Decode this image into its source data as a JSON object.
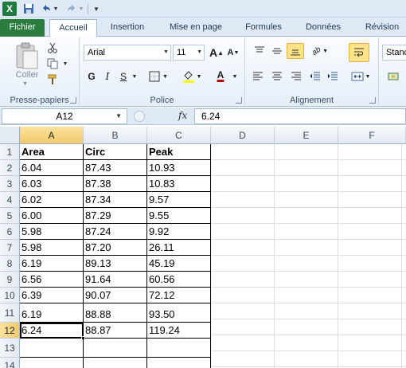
{
  "qat": {
    "app_icon": "excel-icon",
    "save_icon": "save-icon",
    "undo_icon": "undo-icon",
    "redo_icon": "redo-icon",
    "customize_icon": "chevron-down-icon"
  },
  "tabs": [
    {
      "label": "Fichier"
    },
    {
      "label": "Accueil"
    },
    {
      "label": "Insertion"
    },
    {
      "label": "Mise en page"
    },
    {
      "label": "Formules"
    },
    {
      "label": "Données"
    },
    {
      "label": "Révision"
    }
  ],
  "ribbon": {
    "clipboard": {
      "label": "Presse-papiers",
      "paste_label": "Coller"
    },
    "font": {
      "label": "Police",
      "font_name": "Arial",
      "font_size": "11",
      "grow_label": "A",
      "shrink_label": "A",
      "bold_label": "G",
      "italic_label": "I",
      "underline_label": "S",
      "color_label": "A"
    },
    "alignment": {
      "label": "Alignement"
    },
    "number": {
      "format_value": "Stand"
    }
  },
  "formula_bar": {
    "name_box": "A12",
    "fx_label": "fx",
    "content": "6.24"
  },
  "grid": {
    "columns": [
      "A",
      "B",
      "C",
      "D",
      "E",
      "F"
    ],
    "rows": [
      "1",
      "2",
      "3",
      "4",
      "5",
      "6",
      "7",
      "8",
      "9",
      "10",
      "11",
      "12",
      "13",
      "14"
    ],
    "headers": [
      "Area",
      "Circ",
      "Peak"
    ],
    "data": [
      [
        "6.04",
        "87.43",
        "10.93"
      ],
      [
        "6.03",
        "87.38",
        "10.83"
      ],
      [
        "6.02",
        "87.34",
        "9.57"
      ],
      [
        "6.00",
        "87.29",
        "9.55"
      ],
      [
        "5.98",
        "87.24",
        "9.92"
      ],
      [
        "5.98",
        "87.20",
        "26.11"
      ],
      [
        "6.19",
        "89.13",
        "45.19"
      ],
      [
        "6.56",
        "91.64",
        "60.56"
      ],
      [
        "6.39",
        "90.07",
        "72.12"
      ],
      [
        "6.19",
        "88.88",
        "93.50"
      ],
      [
        "6.24",
        "88.87",
        "119.24"
      ]
    ],
    "active_cell": "A12"
  },
  "colors": {
    "file_tab": "#2a7d3f",
    "selection_header": "#f4c96a",
    "highlight_button": "#ffe38b"
  }
}
